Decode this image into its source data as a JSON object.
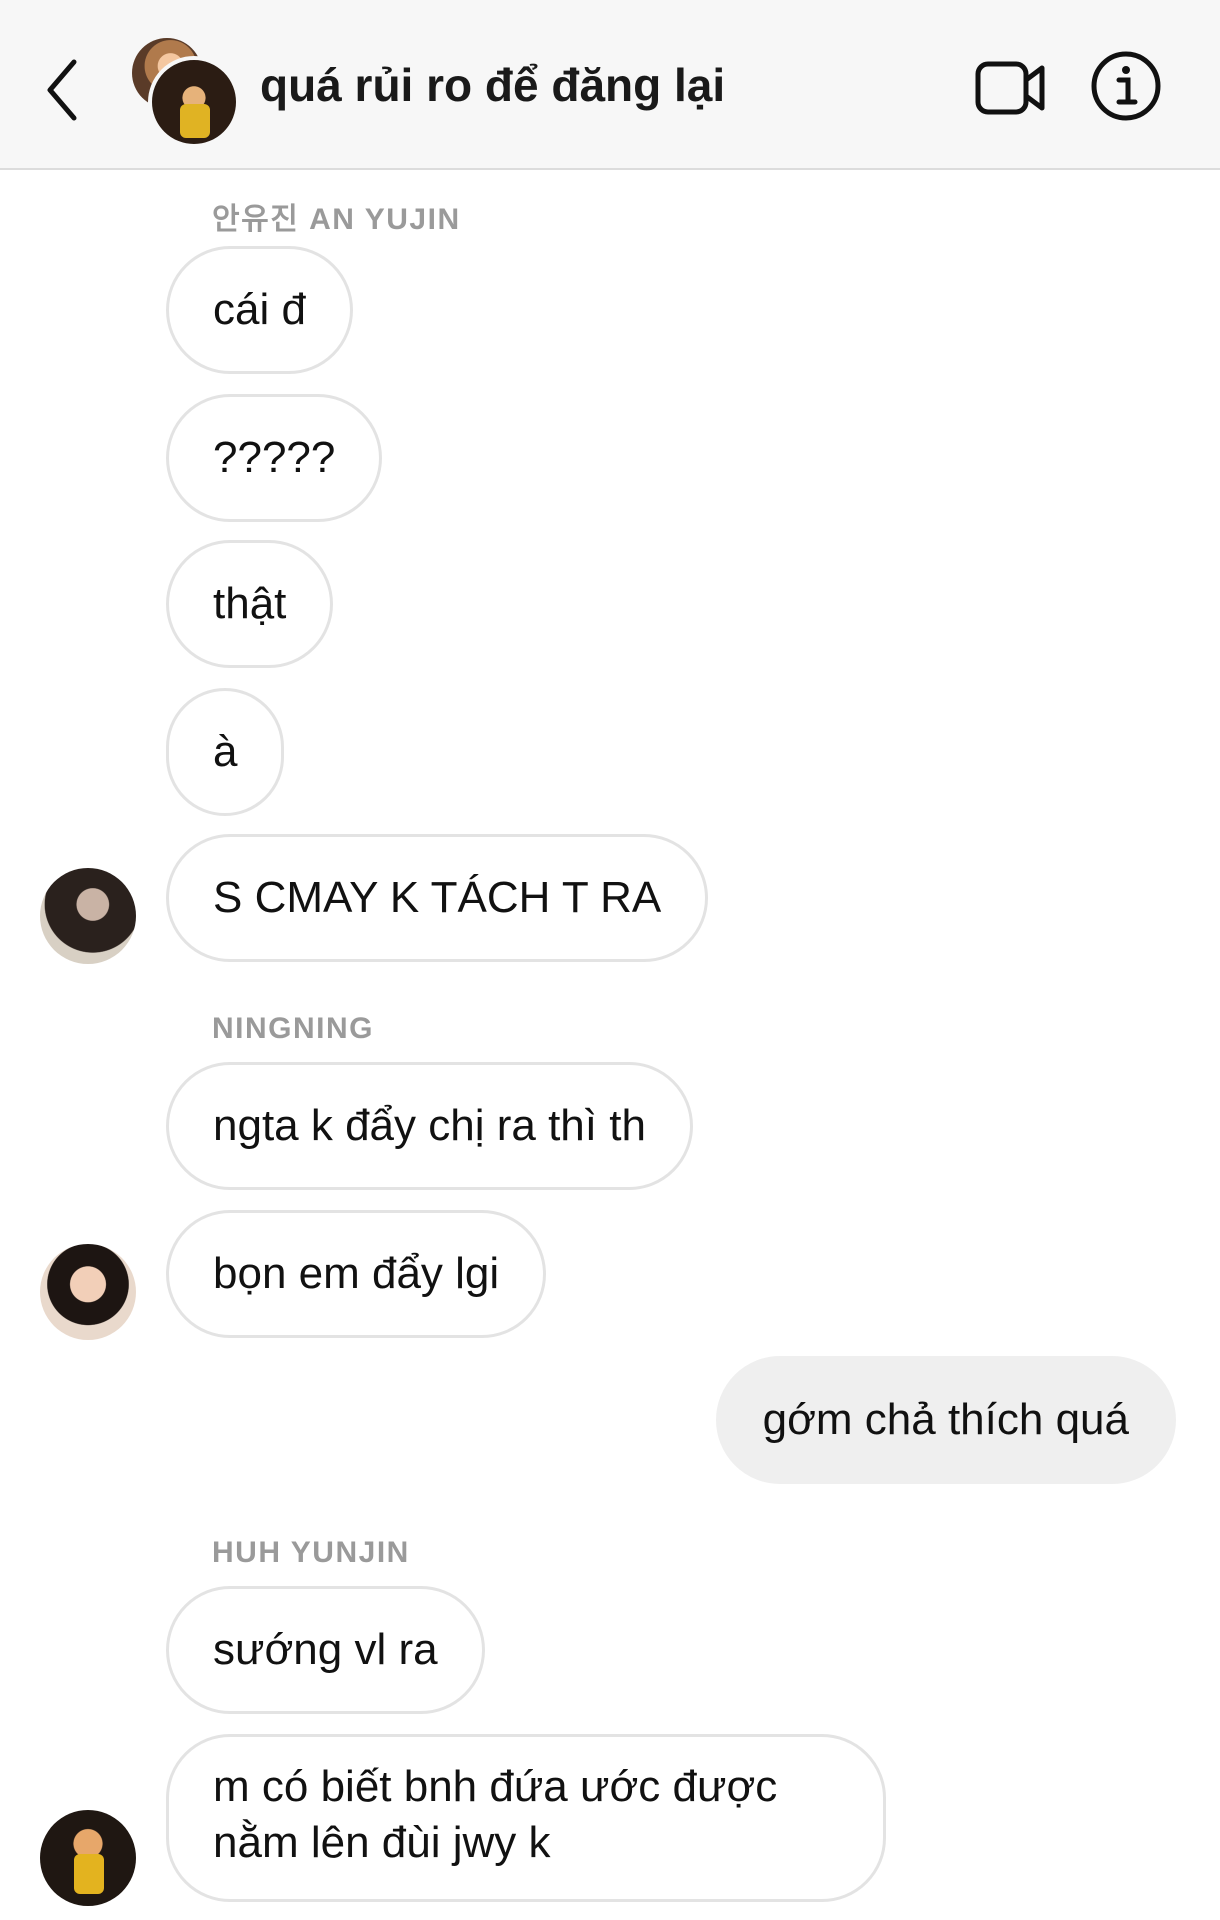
{
  "header": {
    "title": "quá rủi ro để đăng lại"
  },
  "messages": [
    {
      "sender": "안유진 AN YUJIN"
    },
    {
      "text": "cái đ"
    },
    {
      "text": "?????"
    },
    {
      "text": "thật"
    },
    {
      "text": "à"
    },
    {
      "text": "S CMAY K TÁCH T RA"
    },
    {
      "sender": "NINGNING"
    },
    {
      "text": "ngta k đẩy chị ra thì th"
    },
    {
      "text": "bọn em đẩy lgi"
    },
    {
      "text": "gớm chả thích quá"
    },
    {
      "sender": "HUH YUNJIN"
    },
    {
      "text": "sướng vl ra"
    },
    {
      "text": "m có biết bnh đứa ước được nằm lên đùi jwy k"
    }
  ],
  "icons": {
    "back": "chevron-left-icon",
    "video": "video-camera-icon",
    "info": "info-icon"
  },
  "colors": {
    "header_bg": "#f7f7f7",
    "bubble_border": "#e3e3e3",
    "own_bubble_bg": "#efefef",
    "sender_label": "#9a9a9a"
  }
}
